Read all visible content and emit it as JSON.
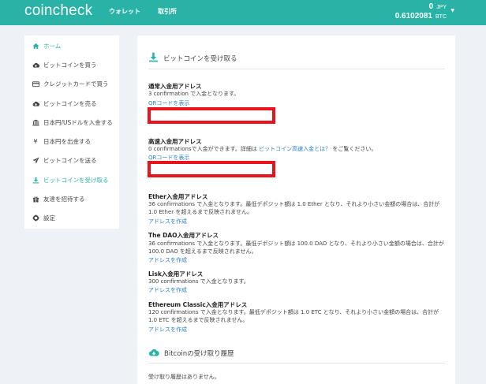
{
  "header": {
    "logo": "coincheck",
    "nav": [
      "ウォレット",
      "取引所"
    ],
    "balance_jpy": "0",
    "balance_jpy_unit": "JPY",
    "balance_btc": "0.6102081",
    "balance_btc_unit": "BTC"
  },
  "sidebar": {
    "items": [
      {
        "label": "ホーム",
        "icon": "home-icon"
      },
      {
        "label": "ビットコインを買う",
        "icon": "cloud-upload-icon"
      },
      {
        "label": "クレジットカードで買う",
        "icon": "credit-card-icon"
      },
      {
        "label": "ビットコインを売る",
        "icon": "cloud-download-icon"
      },
      {
        "label": "日本円/USドルを入金する",
        "icon": "bank-icon"
      },
      {
        "label": "日本円を出金する",
        "icon": "yen-icon"
      },
      {
        "label": "ビットコインを送る",
        "icon": "send-icon"
      },
      {
        "label": "ビットコインを受け取る",
        "icon": "download-icon"
      },
      {
        "label": "友達を招待する",
        "icon": "gift-icon"
      },
      {
        "label": "設定",
        "icon": "gear-icon"
      }
    ],
    "active_index": 7
  },
  "main": {
    "title": "ビットコインを受け取る",
    "normal": {
      "title": "通常入金用アドレス",
      "desc": "3 confirmation で入金となります。",
      "qr_link": "QRコードを表示"
    },
    "fast": {
      "title": "高速入金用アドレス",
      "desc_before": "0 confirmationsで入金ができます。詳細は",
      "desc_link": "ビットコイン高速入金とは？",
      "desc_after": "をご覧ください。",
      "qr_link": "QRコードを表示"
    },
    "ether": {
      "title": "Ether入金用アドレス",
      "desc": "36 confirmations で入金となります。最低デポジット額は 1.0 Ether となり、それより小さい金額の場合は、合計が 1.0 Ether を超えるまで反映されません。",
      "link": "アドレスを作成"
    },
    "dao": {
      "title": "The DAO入金用アドレス",
      "desc": "36 confirmations で入金となります。最低デポジット額は 100.0 DAO となり、それより小さい金額の場合は、合計が 100.0 DAO を超えるまで反映されません。",
      "link": "アドレスを作成"
    },
    "lisk": {
      "title": "Lisk入金用アドレス",
      "desc": "300 confirmations で入金となります。",
      "link": "アドレスを作成"
    },
    "etc": {
      "title": "Ethereum Classic入金用アドレス",
      "desc": "120 confirmations で入金となります。最低デポジット額は 1.0 ETC となり、それより小さい金額の場合は、合計が 1.0 ETC を超えるまで反映されません。",
      "link": "アドレスを作成"
    },
    "history_title": "Bitcoinの受け取り履歴",
    "history_empty": "受け取り履歴はありません。"
  },
  "colors": {
    "brand": "#29b3a6",
    "link": "#2d7fc4",
    "redaction": "#e8141b"
  }
}
